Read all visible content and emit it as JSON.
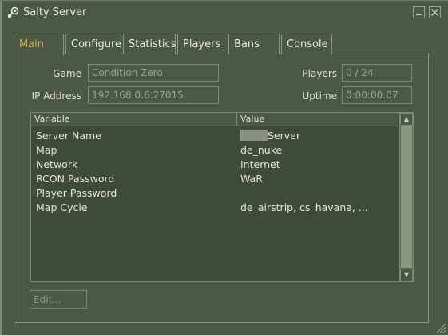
{
  "window": {
    "title": "Salty Server"
  },
  "tabs": [
    {
      "label": "Main",
      "active": true
    },
    {
      "label": "Configure",
      "active": false
    },
    {
      "label": "Statistics",
      "active": false
    },
    {
      "label": "Players",
      "active": false
    },
    {
      "label": "Bans",
      "active": false
    },
    {
      "label": "Console",
      "active": false
    }
  ],
  "info": {
    "game_label": "Game",
    "game_value": "Condition Zero",
    "ip_label": "IP Address",
    "ip_value": "192.168.0.6:27015",
    "players_label": "Players",
    "players_value": "0 / 24",
    "uptime_label": "Uptime",
    "uptime_value": "0:00:00:07"
  },
  "table": {
    "headers": {
      "variable": "Variable",
      "value": "Value"
    },
    "rows": [
      {
        "variable": "Server Name",
        "value": "Server",
        "value_masked": true
      },
      {
        "variable": "Map",
        "value": "de_nuke"
      },
      {
        "variable": "Network",
        "value": "Internet"
      },
      {
        "variable": "RCON Password",
        "value": "WaR"
      },
      {
        "variable": "Player Password",
        "value": ""
      },
      {
        "variable": "Map Cycle",
        "value": "de_airstrip, cs_havana, ..."
      }
    ]
  },
  "buttons": {
    "edit_label": "Edit..."
  },
  "icons": {
    "app": "steam-icon",
    "minimize": "minimize-icon",
    "close": "close-icon"
  },
  "colors": {
    "background": "#4c5844",
    "active_tab_text": "#c9b04e",
    "table_bg": "#3f4a39"
  }
}
